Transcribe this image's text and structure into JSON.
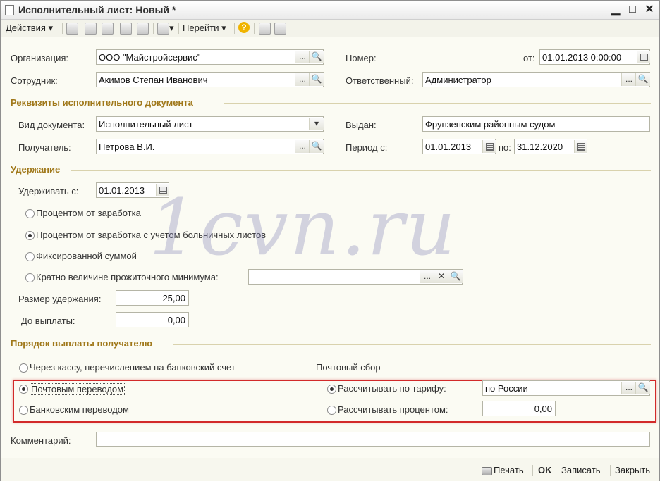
{
  "window": {
    "title": "Исполнительный лист: Новый *",
    "min": "▁",
    "max": "□",
    "close": "✕"
  },
  "toolbar": {
    "actions": "Действия",
    "goto": "Перейти",
    "help": "?",
    "dropdown": "▾"
  },
  "common": {
    "dots": "...",
    "search": "🔍",
    "clear": "✕",
    "combo": "▾"
  },
  "form": {
    "org_label": "Организация:",
    "org_value": "ООО \"Майстройсервис\"",
    "number_label": "Номер:",
    "from_label": "от:",
    "date_value": "01.01.2013  0:00:00",
    "employee_label": "Сотрудник:",
    "employee_value": "Акимов Степан Иванович",
    "responsible_label": "Ответственный:",
    "responsible_value": "Администратор"
  },
  "rekv": {
    "title": "Реквизиты исполнительного документа",
    "doctype_label": "Вид документа:",
    "doctype_value": "Исполнительный лист",
    "issued_label": "Выдан:",
    "issued_value": "Фрунзенским районным судом",
    "recipient_label": "Получатель:",
    "recipient_value": "Петрова В.И.",
    "period_label": "Период с:",
    "period_from": "01.01.2013",
    "period_to_label": "по:",
    "period_to": "31.12.2020"
  },
  "uderzh": {
    "title": "Удержание",
    "start_label": "Удерживать с:",
    "start_value": "01.01.2013",
    "opt1": "Процентом от заработка",
    "opt2": "Процентом от заработка с учетом больничных листов",
    "opt3": "Фиксированной суммой",
    "opt4": "Кратно величине прожиточного минимума:",
    "amount_label": "Размер удержания:",
    "amount_value": "25,00",
    "limit_label": "До выплаты:",
    "limit_value": "0,00"
  },
  "payment": {
    "title": "Порядок выплаты получателю",
    "opt_cash": "Через кассу, перечислением на банковский счет",
    "postal_fee": "Почтовый сбор",
    "opt_postal": "Почтовым переводом",
    "opt_bank": "Банковским переводом",
    "tariff_label": "Рассчитывать по тарифу:",
    "tariff_value": "по России",
    "percent_label": "Рассчитывать процентом:",
    "percent_value": "0,00"
  },
  "comment": {
    "label": "Комментарий:",
    "value": ""
  },
  "watermark": "1cvn.ru",
  "statusbar": {
    "print": "Печать",
    "ok": "OK",
    "save": "Записать",
    "close": "Закрыть"
  }
}
